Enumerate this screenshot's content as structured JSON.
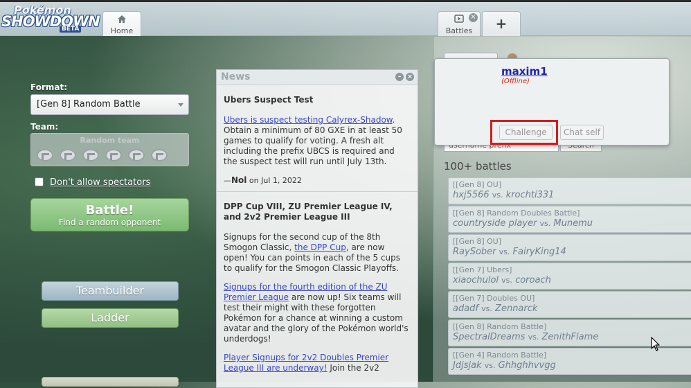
{
  "logo": {
    "line1": "Pokémon",
    "line2": "SHOWDOWN",
    "badge": "BETA"
  },
  "tabs": {
    "home": {
      "label": "Home",
      "icon": "home-icon"
    },
    "battles": {
      "label": "Battles",
      "icon": "video-icon",
      "close": "×"
    },
    "add": {
      "label": "+"
    }
  },
  "left": {
    "format_label": "Format:",
    "format_value": "[Gen 8] Random Battle",
    "team_label": "Team:",
    "team_placeholder": "Random team",
    "spectators_label": "Don't allow spectators",
    "battle_button": {
      "title": "Battle!",
      "subtitle": "Find a random opponent"
    },
    "teambuilder_label": "Teambuilder",
    "ladder_label": "Ladder"
  },
  "news": {
    "title": "News",
    "items": [
      {
        "headline": "Ubers Suspect Test",
        "link": "Ubers is suspect testing Calyrex-Shadow",
        "body": ". Obtain a minimum of 80 GXE in at least 50 games to qualify for voting. A fresh alt including the prefix UBCS is required and the suspect test will run until July 13th.",
        "author": "Nol",
        "date": "on Jul 1, 2022"
      },
      {
        "headline": "DPP Cup VIII, ZU Premier League IV, and 2v2 Premier League III",
        "p1_before": "Signups for the second cup of the 8th Smogon Classic, ",
        "p1_link": "the DPP Cup",
        "p1_after": ", are now open! You can points in each of the 5 cups to qualify for the Smogon Classic Playoffs.",
        "p2_link": "Signups for the fourth edition of the ZU Premier League",
        "p2_after": " are now up! Six teams will test their might with these forgotten Pokémon for a chance at winning a custom avatar and the glory of the Pokémon world's underdogs!",
        "p3_link": "Player Signups for 2v2 Doubles Premier League III are underway!",
        "p3_after": " Join the 2v2"
      }
    ]
  },
  "battles_panel": {
    "filter_placeholder": "username prefix",
    "search_label": "Search",
    "count_label": "100+ battles",
    "list": [
      {
        "format": "[[Gen 8] OU]",
        "p1": "hxj5566",
        "p2": "krochti331"
      },
      {
        "format": "[[Gen 8] Random Doubles Battle]",
        "p1": "countryside player",
        "p2": "Munemu"
      },
      {
        "format": "[[Gen 8] OU]",
        "p1": "RaySober",
        "p2": "FairyKing14"
      },
      {
        "format": "[[Gen 7] Ubers]",
        "p1": "xiaochulol",
        "p2": "coroach"
      },
      {
        "format": "[[Gen 7] Doubles OU]",
        "p1": "adadf",
        "p2": "Zennarck"
      },
      {
        "format": "[[Gen 8] Random Battle]",
        "p1": "SpectralDreams",
        "p2": "ZenithFlame"
      },
      {
        "format": "[[Gen 4] Random Battle]",
        "p1": "Jdjsjak",
        "p2": "Ghhghhvvgg"
      }
    ],
    "vs": "vs."
  },
  "user_popup": {
    "username": "maxim1",
    "status": "(Offline)",
    "challenge_label": "Challenge",
    "chat_self_label": "Chat self"
  },
  "colors": {
    "link": "#3a46c8",
    "username": "#2323b0",
    "offline": "#d21",
    "highlight": "#d61b1b"
  }
}
